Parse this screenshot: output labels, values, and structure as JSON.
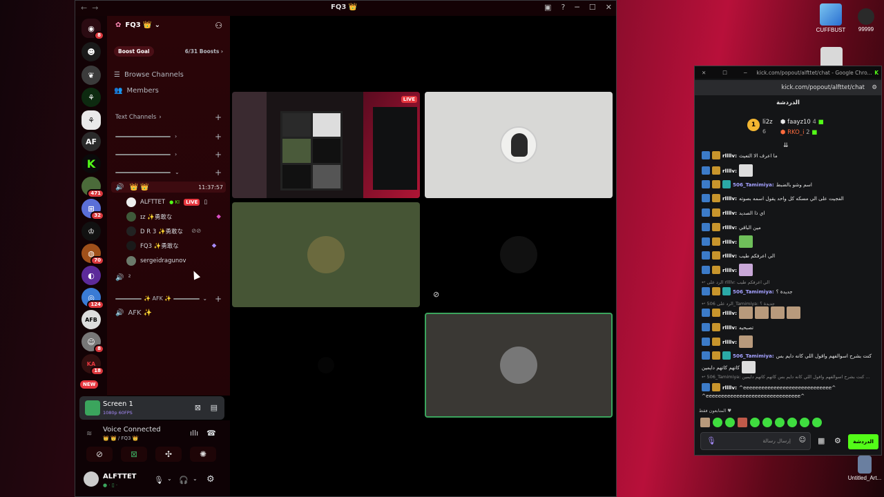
{
  "desktop": {
    "icons": [
      {
        "label": "CUFFBUST"
      },
      {
        "label": "99999"
      },
      {
        "label": "Untitled_Art..."
      }
    ]
  },
  "discord": {
    "title": "FQ3 👑",
    "server_name": "FQ3 👑",
    "boost_goal_label": "Boost Goal",
    "boost_count": "6/31 Boosts",
    "browse_channels": "Browse Channels",
    "members": "Members",
    "text_channels": "Text Channels",
    "voice_channel_name": "👑 👑",
    "voice_timer": "11:37:57",
    "voice_users": [
      {
        "name": "ALFTTET",
        "badge": "LIVE"
      },
      {
        "name": "ɪᴢ ✨勇敢な"
      },
      {
        "name": "D R 3 ✨勇敢な"
      },
      {
        "name": "FQ3 ✨勇敢な"
      },
      {
        "name": "sergeidragunov"
      }
    ],
    "voice2_name": "²",
    "afk_category": "✨ AFK ✨",
    "afk_channel": "AFK ✨",
    "new_badge": "NEW",
    "guild_badges": [
      "8",
      "471",
      "32",
      "70",
      "124",
      "8",
      "18"
    ],
    "guild_af": "AF",
    "screen_title": "Screen 1",
    "screen_sub": "1080p 60FPS",
    "voice_connected": "Voice Connected",
    "voice_connected_sub": "👑 👑 / FQ3 👑",
    "user_name": "ALFTTET",
    "user_status": "● · ▯ ·",
    "live_tile_badge": "LIVE"
  },
  "kick": {
    "window_title": "kick.com/popout/alfttet/chat - Google Chro...",
    "url": "kick.com/popout/alfttet/chat",
    "chat_label": "الدردشة",
    "leaders": [
      {
        "rank": "1",
        "name": "li2z",
        "value": "6"
      },
      {
        "name": "faayz10",
        "value": "4"
      },
      {
        "name": "RKO_i",
        "value": "2"
      }
    ],
    "messages": [
      {
        "user": "rllllv:",
        "text": "ما اعرف الا التعيث"
      },
      {
        "user": "rllllv:",
        "text": ""
      },
      {
        "user": "506_Tamimiya:",
        "text": "اسم وشو بالضبط"
      },
      {
        "user": "rllllv:",
        "text": "الفجيت على الي مسكه كل واحد يقول اسمه بصوته"
      },
      {
        "user": "rllllv:",
        "text": "اي ذا الصديد"
      },
      {
        "user": "rllllv:",
        "text": "مين الباقي"
      },
      {
        "user": "rllllv:",
        "text": ""
      },
      {
        "user": "rllllv:",
        "text": "الي اعرفكم طيب"
      },
      {
        "user": "rllllv:",
        "text": ""
      },
      {
        "user": "506_Tamimiya:",
        "text": "جديدة ؟"
      },
      {
        "user": "rllllv:",
        "text": ""
      },
      {
        "user": "rllllv:",
        "text": "تصبحيه"
      },
      {
        "user": "rllllv:",
        "text": ""
      },
      {
        "user": "506_Tamimiya:",
        "text": "كنت بشرح اسوالفهم واقول اللي كانه دايم بس"
      },
      {
        "user": "rllllv:",
        "text": "^eeeeeeeeeeeeeeeeeeeeeeeeeeeee^"
      }
    ],
    "msg14_line2": "كاتهم كاتهم دايمين",
    "msg15_line2": "^eeeeeeeeeeeeeeeeeeeeeeeeeeeeeee^",
    "reply1": "↩ الرد على rllllv: الي اعرفكم طيب",
    "reply2": "↩ الرد على 506_Tamimiya: جديدة ؟",
    "reply3": "↩ 506_Tamimiya: كنت بشرح اسوالفهم واقول اللي كانه دايم بس كاتهم كاتهم دايمين ...",
    "emote_label": "المتابعون فقط ♥",
    "input_placeholder": "إرسال رسالة",
    "send_label": "الدردشة"
  }
}
